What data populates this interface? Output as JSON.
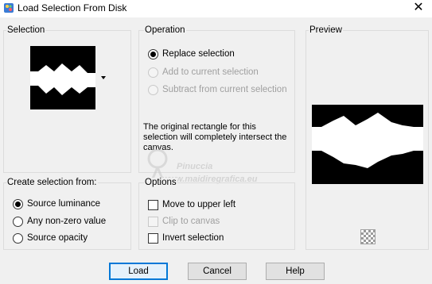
{
  "window": {
    "title": "Load Selection From Disk",
    "close_glyph": "✕",
    "icon": "paint-palette-icon"
  },
  "selection": {
    "label": "Selection"
  },
  "operation": {
    "label": "Operation",
    "options": [
      {
        "label": "Replace selection",
        "checked": true,
        "enabled": true
      },
      {
        "label": "Add to current selection",
        "checked": false,
        "enabled": false
      },
      {
        "label": "Subtract from current selection",
        "checked": false,
        "enabled": false
      }
    ],
    "info": "The original rectangle for this selection will completely intersect the canvas."
  },
  "preview": {
    "label": "Preview",
    "checker_icon": "transparency-checker-icon"
  },
  "create_from": {
    "label": "Create selection from:",
    "options": [
      {
        "label": "Source luminance",
        "checked": true
      },
      {
        "label": "Any non-zero value",
        "checked": false
      },
      {
        "label": "Source opacity",
        "checked": false
      }
    ]
  },
  "options": {
    "label": "Options",
    "items": [
      {
        "label": "Move to upper left",
        "checked": false,
        "enabled": true
      },
      {
        "label": "Clip to canvas",
        "checked": false,
        "enabled": false
      },
      {
        "label": "Invert selection",
        "checked": false,
        "enabled": true
      }
    ]
  },
  "buttons": {
    "load": "Load",
    "cancel": "Cancel",
    "help": "Help"
  },
  "watermark": {
    "line1": "Pinuccia",
    "line2": "www.maidiregrafica.eu"
  },
  "colors": {
    "background": "#f0f0f0",
    "default_button_border": "#0078d7",
    "disabled_text": "#a0a0a0"
  }
}
